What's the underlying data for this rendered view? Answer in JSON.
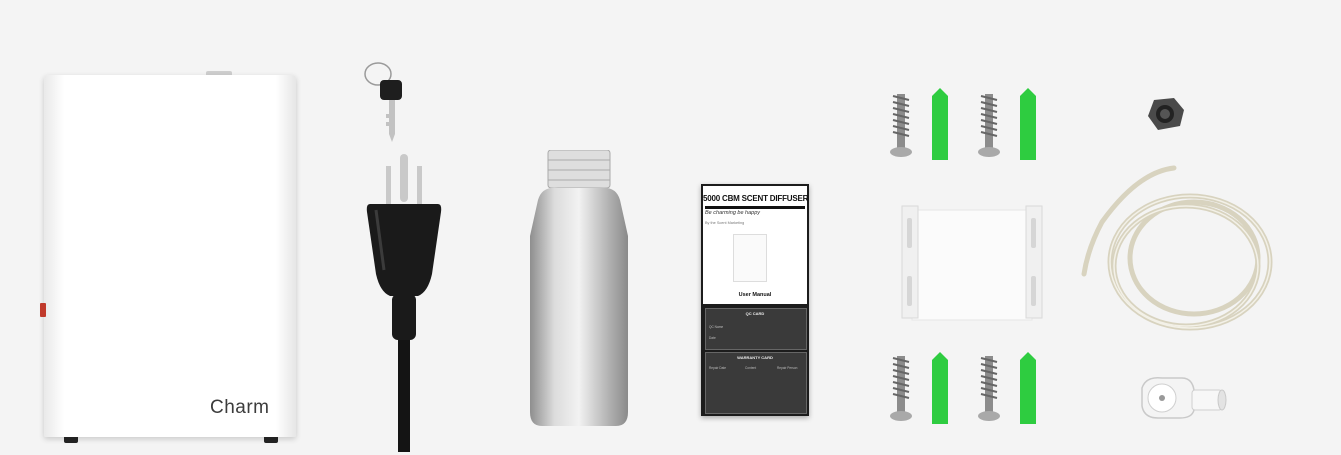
{
  "diffuser": {
    "brand": "Charm"
  },
  "manual": {
    "title": "5000 CBM SCENT DIFFUSER",
    "slogan": "Be charming be happy",
    "byline": "By the Scent Marketing",
    "cover_label": "User Manual",
    "qc_card": {
      "title": "QC CARD",
      "fields": [
        "QC Name",
        "Date"
      ]
    },
    "warranty_card": {
      "title": "WARRANTY CARD",
      "columns": [
        "Repair Date",
        "Content",
        "Repair Person"
      ]
    }
  },
  "colors": {
    "background": "#f4f4f4",
    "diffuser_body": "#ffffff",
    "plug": "#1a1a1a",
    "bottle": "#c9c9c9",
    "wall_anchor": "#2ecc40",
    "screw": "#9a9a9a",
    "tube": "#e6e3d6"
  }
}
